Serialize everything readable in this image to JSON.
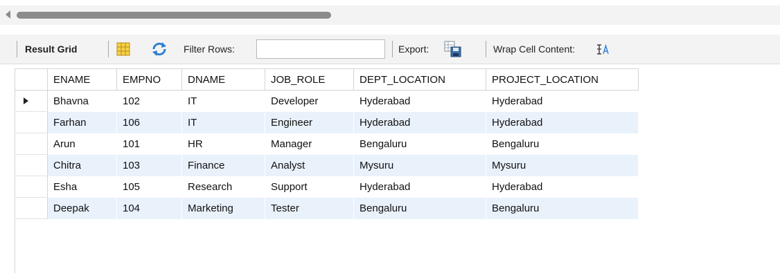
{
  "toolbar": {
    "result_grid_label": "Result Grid",
    "filter_label": "Filter Rows:",
    "filter_value": "",
    "export_label": "Export:",
    "wrap_label": "Wrap Cell Content:"
  },
  "grid": {
    "columns": [
      "ENAME",
      "EMPNO",
      "DNAME",
      "JOB_ROLE",
      "DEPT_LOCATION",
      "PROJECT_LOCATION"
    ],
    "rows": [
      [
        "Bhavna",
        "102",
        "IT",
        "Developer",
        "Hyderabad",
        "Hyderabad"
      ],
      [
        "Farhan",
        "106",
        "IT",
        "Engineer",
        "Hyderabad",
        "Hyderabad"
      ],
      [
        "Arun",
        "101",
        "HR",
        "Manager",
        "Bengaluru",
        "Bengaluru"
      ],
      [
        "Chitra",
        "103",
        "Finance",
        "Analyst",
        "Mysuru",
        "Mysuru"
      ],
      [
        "Esha",
        "105",
        "Research",
        "Support",
        "Hyderabad",
        "Hyderabad"
      ],
      [
        "Deepak",
        "104",
        "Marketing",
        "Tester",
        "Bengaluru",
        "Bengaluru"
      ]
    ]
  },
  "colors": {
    "alt_row": "#e9f1fb",
    "toolbar_bg": "#f3f3f3",
    "grid_line": "#d4d4d4"
  }
}
